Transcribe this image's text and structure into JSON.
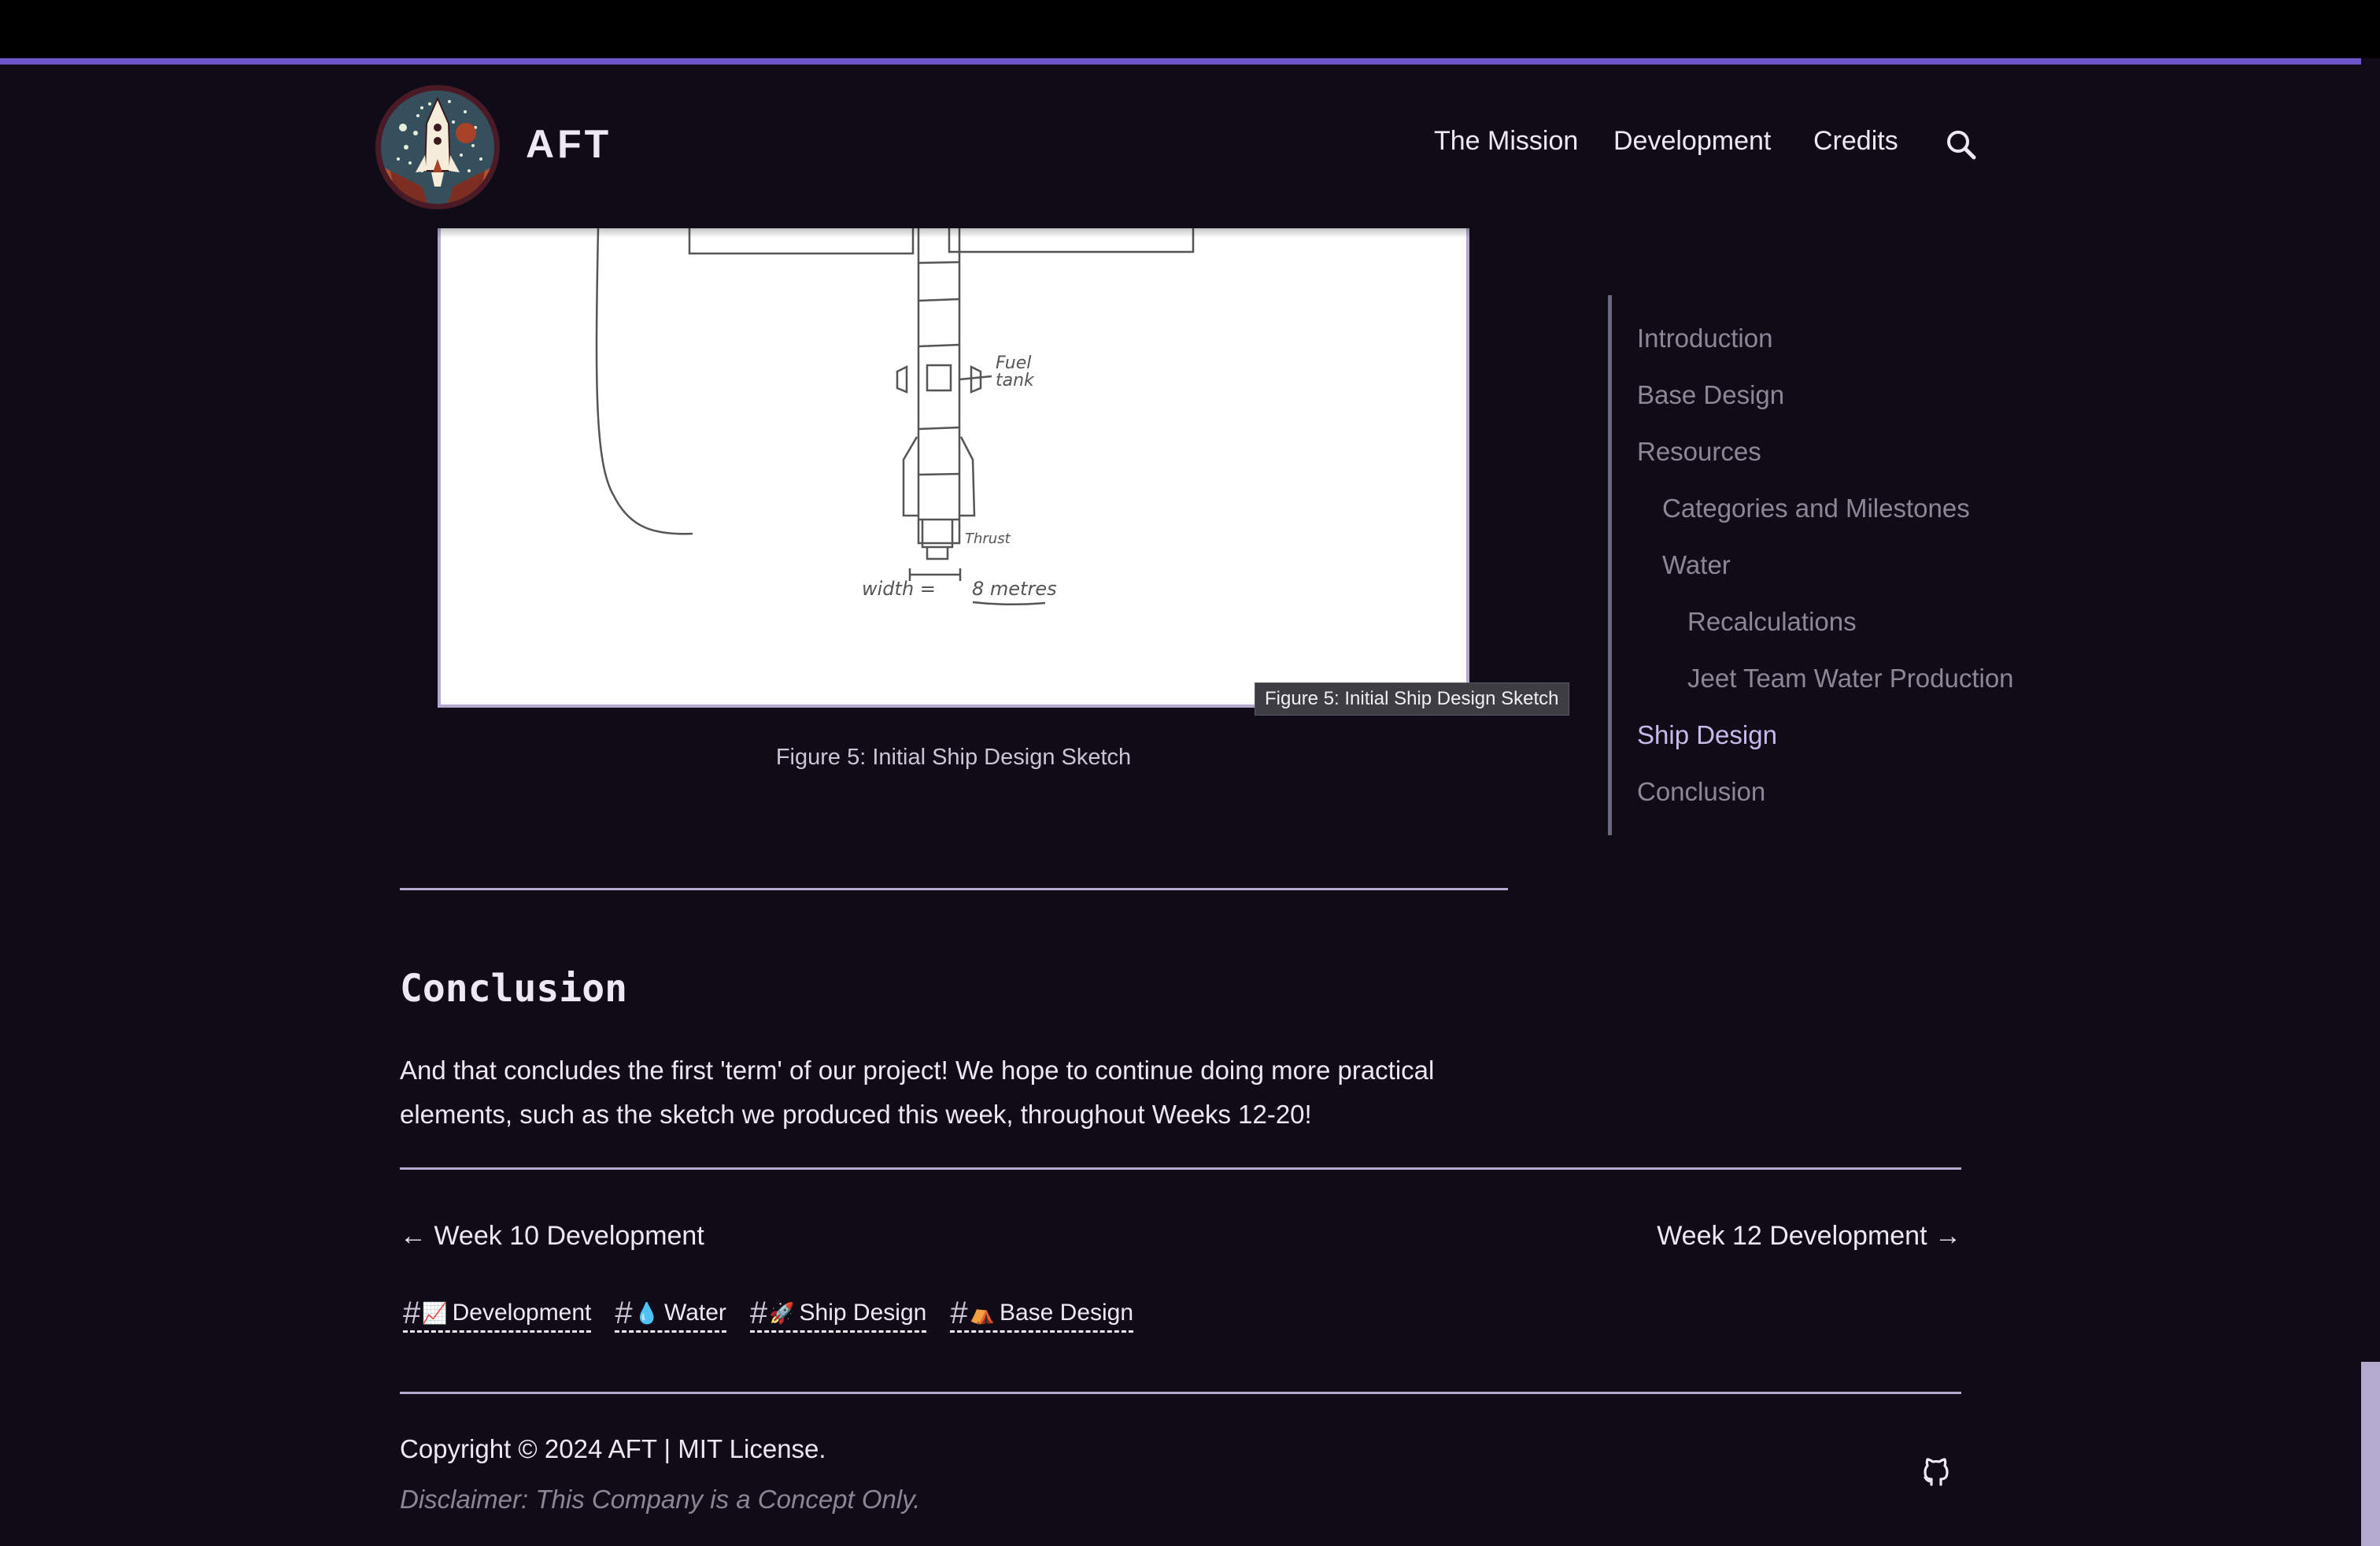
{
  "header": {
    "brand": "AFT",
    "nav": [
      {
        "label": "The Mission"
      },
      {
        "label": "Development"
      },
      {
        "label": "Credits"
      }
    ],
    "search_icon": "search-icon",
    "accent_color": "#6b57c9"
  },
  "figure": {
    "sketch_labels": {
      "fuel": "Fuel",
      "tank": "tank",
      "thrust": "Thrust",
      "width": "width =",
      "metres": "8 metres"
    },
    "tooltip": "Figure 5: Initial Ship Design Sketch",
    "caption": "Figure 5: Initial Ship Design Sketch"
  },
  "article": {
    "heading": "Conclusion",
    "paragraph": "And that concludes the first 'term' of our project! We hope to continue doing more practical elements, such as the sketch we produced this week, throughout Weeks 12-20!"
  },
  "pager": {
    "prev": "← Week 10 Development",
    "next": "Week 12 Development →"
  },
  "tags": [
    {
      "hash": "#",
      "emoji": "📈",
      "label": "Development"
    },
    {
      "hash": "#",
      "emoji": "💧",
      "label": "Water"
    },
    {
      "hash": "#",
      "emoji": "🚀",
      "label": "Ship Design"
    },
    {
      "hash": "#",
      "emoji": "⛺",
      "label": "Base Design"
    }
  ],
  "footer": {
    "copyright": "Copyright © 2024 AFT | MIT License.",
    "disclaimer": "Disclaimer: This Company is a Concept Only.",
    "github_icon": "github-icon"
  },
  "toc": {
    "items": [
      {
        "label": "Introduction",
        "level": 1,
        "active": false
      },
      {
        "label": "Base Design",
        "level": 1,
        "active": false
      },
      {
        "label": "Resources",
        "level": 1,
        "active": false
      },
      {
        "label": "Categories and Milestones",
        "level": 2,
        "active": false
      },
      {
        "label": "Water",
        "level": 2,
        "active": false
      },
      {
        "label": "Recalculations",
        "level": 3,
        "active": false
      },
      {
        "label": "Jeet Team Water Production",
        "level": 3,
        "active": false
      },
      {
        "label": "Ship Design",
        "level": 1,
        "active": true
      },
      {
        "label": "Conclusion",
        "level": 1,
        "active": false
      }
    ],
    "active_color": "#c4bbea",
    "inactive_color": "#8b8799"
  }
}
